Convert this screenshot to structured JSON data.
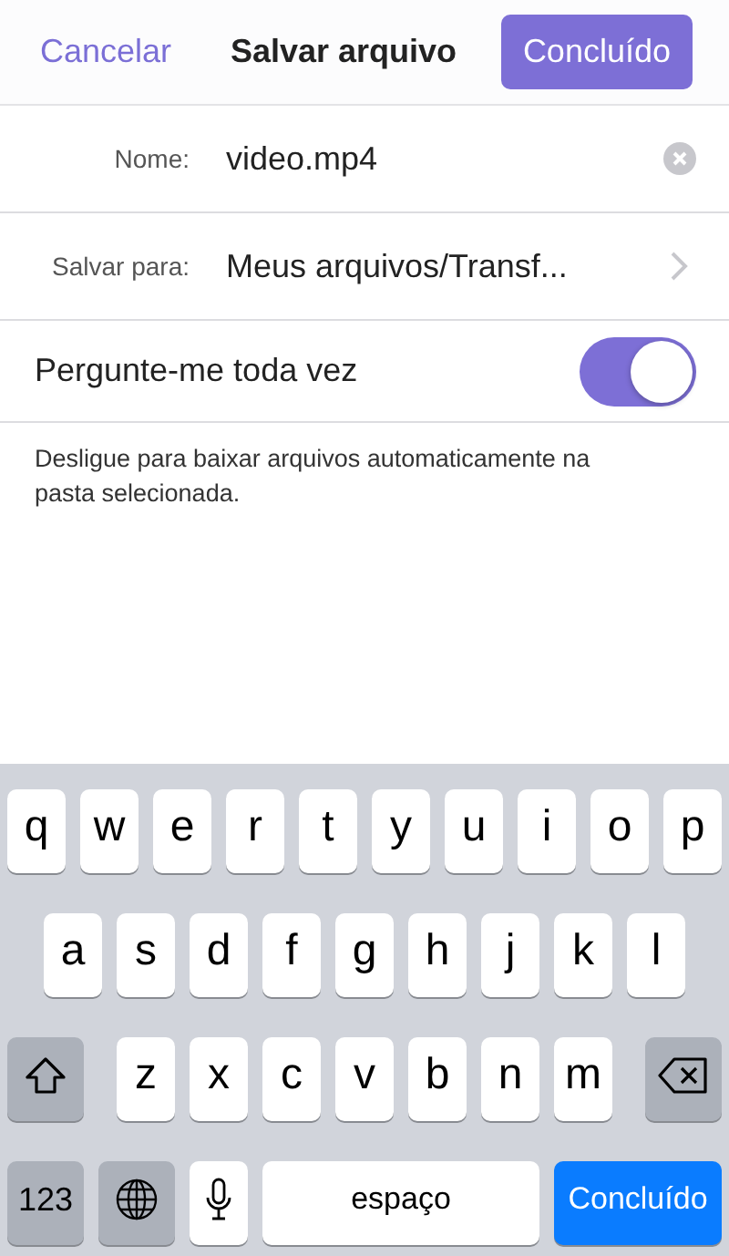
{
  "header": {
    "cancel": "Cancelar",
    "title": "Salvar arquivo",
    "done": "Concluído"
  },
  "fields": [
    {
      "kind": "input",
      "label": "Nome:",
      "value": "video.mp4"
    },
    {
      "kind": "link",
      "label": "Salvar para:",
      "value": "Meus arquivos/Transf..."
    }
  ],
  "toggle": {
    "label": "Pergunte-me toda vez",
    "on": true
  },
  "note": "Desligue para baixar arquivos automaticamente na pasta selecionada.",
  "keyboard": {
    "rows": [
      [
        {
          "kind": "letter",
          "label": "q"
        },
        {
          "kind": "letter",
          "label": "w"
        },
        {
          "kind": "letter",
          "label": "e"
        },
        {
          "kind": "letter",
          "label": "r"
        },
        {
          "kind": "letter",
          "label": "t"
        },
        {
          "kind": "letter",
          "label": "y"
        },
        {
          "kind": "letter",
          "label": "u"
        },
        {
          "kind": "letter",
          "label": "i"
        },
        {
          "kind": "letter",
          "label": "o"
        },
        {
          "kind": "letter",
          "label": "p"
        }
      ],
      [
        {
          "kind": "letter",
          "label": "a"
        },
        {
          "kind": "letter",
          "label": "s"
        },
        {
          "kind": "letter",
          "label": "d"
        },
        {
          "kind": "letter",
          "label": "f"
        },
        {
          "kind": "letter",
          "label": "g"
        },
        {
          "kind": "letter",
          "label": "h"
        },
        {
          "kind": "letter",
          "label": "j"
        },
        {
          "kind": "letter",
          "label": "k"
        },
        {
          "kind": "letter",
          "label": "l"
        }
      ],
      [
        {
          "kind": "shift"
        },
        {
          "kind": "letter",
          "label": "z"
        },
        {
          "kind": "letter",
          "label": "x"
        },
        {
          "kind": "letter",
          "label": "c"
        },
        {
          "kind": "letter",
          "label": "v"
        },
        {
          "kind": "letter",
          "label": "b"
        },
        {
          "kind": "letter",
          "label": "n"
        },
        {
          "kind": "letter",
          "label": "m"
        },
        {
          "kind": "backspace"
        }
      ]
    ],
    "bottom_row": {
      "numbers": "123",
      "space": "espaço",
      "done": "Concluído"
    }
  }
}
